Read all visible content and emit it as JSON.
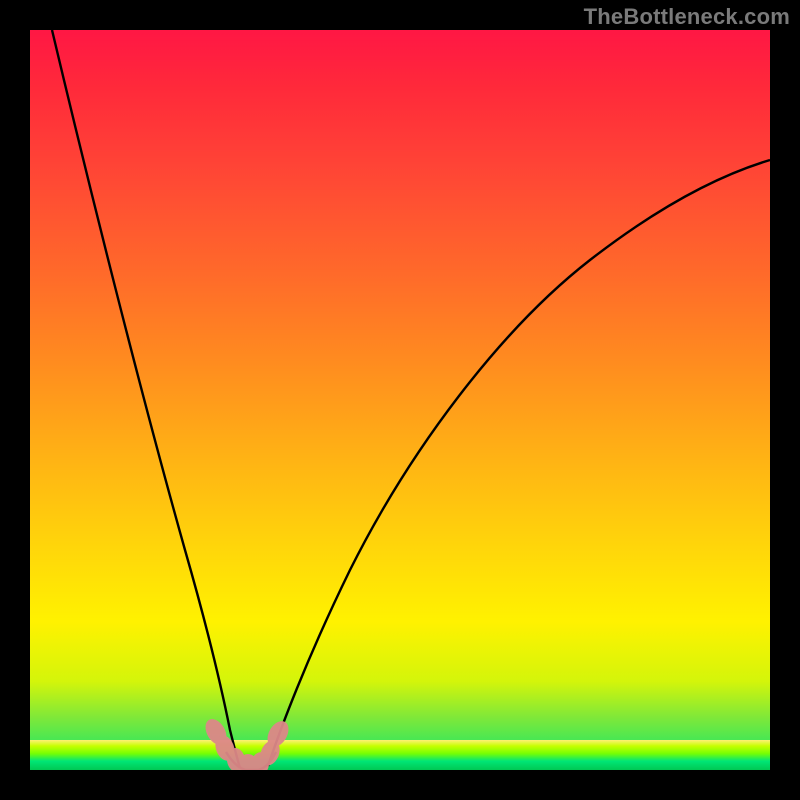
{
  "watermark": "TheBottleneck.com",
  "colors": {
    "gradient_top": "#ff1744",
    "gradient_mid": "#ffd60a",
    "gradient_bottom": "#00e676",
    "curve": "#000000",
    "marker": "#e08080",
    "frame": "#000000"
  },
  "chart_data": {
    "type": "line",
    "title": "",
    "xlabel": "",
    "ylabel": "",
    "xlim": [
      0,
      100
    ],
    "ylim": [
      0,
      100
    ],
    "grid": false,
    "legend": false,
    "series": [
      {
        "name": "left-branch",
        "x": [
          3,
          6,
          10,
          14,
          18,
          21,
          23,
          25,
          26.5,
          28
        ],
        "y": [
          100,
          82,
          62,
          44,
          28,
          16,
          9,
          4,
          2,
          0
        ]
      },
      {
        "name": "right-branch",
        "x": [
          32,
          34,
          37,
          42,
          50,
          60,
          72,
          85,
          100
        ],
        "y": [
          0,
          3,
          9,
          20,
          36,
          51,
          63,
          72,
          80
        ]
      },
      {
        "name": "valley-floor",
        "x": [
          25,
          26,
          27,
          28,
          29,
          30,
          31,
          32
        ],
        "y": [
          3,
          1.5,
          0.5,
          0,
          0,
          0.5,
          1.5,
          3
        ]
      }
    ],
    "markers": {
      "name": "valley-markers",
      "x": [
        24.5,
        25.8,
        27.2,
        28.8,
        30.2,
        31.8,
        32.8
      ],
      "y": [
        5.5,
        3.2,
        1.4,
        0.6,
        0.6,
        2.4,
        5.2
      ]
    },
    "background_gradient": {
      "orientation": "vertical",
      "stops": [
        {
          "pos": 0,
          "color": "#ff1744"
        },
        {
          "pos": 45,
          "color": "#ff8c1f"
        },
        {
          "pos": 80,
          "color": "#fff200"
        },
        {
          "pos": 100,
          "color": "#00e676"
        }
      ]
    }
  }
}
